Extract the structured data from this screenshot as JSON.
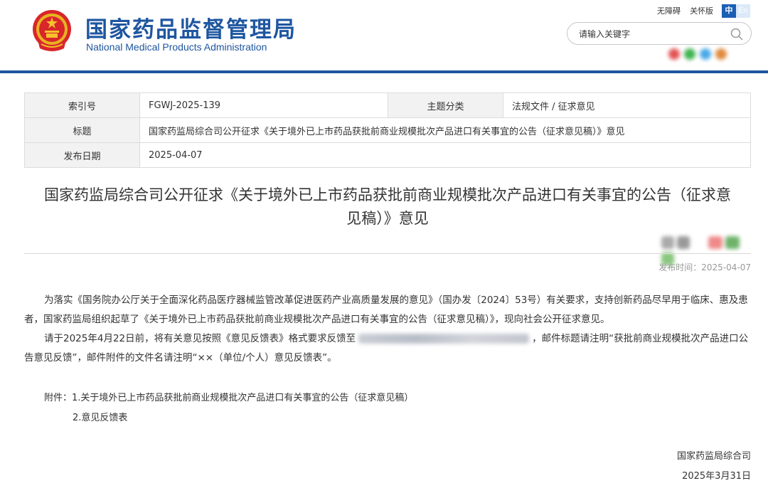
{
  "header": {
    "brand_cn": "国家药品监督管理局",
    "brand_en": "National Medical Products Administration",
    "accessibility_label": "无障碍",
    "elder_mode_label": "关怀版",
    "lang_zh": "中",
    "lang_en": "En",
    "search_placeholder": "请输入关键字",
    "brand_color": "#1e56a0"
  },
  "meta": {
    "index_label": "索引号",
    "index_value": "FGWJ-2025-139",
    "category_label": "主题分类",
    "category_value": "法规文件 / 征求意见",
    "title_label": "标题",
    "title_value": "国家药监局综合司公开征求《关于境外已上市药品获批前商业规模批次产品进口有关事宜的公告（征求意见稿）》意见",
    "date_label": "发布日期",
    "date_value": "2025-04-07"
  },
  "article": {
    "title_line1": "国家药监局综合司公开征求《关于境外已上市药品获批前商业规模批次产品进口有关事宜的公告（征求意",
    "title_line2": "见稿）》意见",
    "pubtime": "发布时间：2025-04-07",
    "para1": "为落实《国务院办公厅关于全面深化药品医疗器械监管改革促进医药产业高质量发展的意见》（国办发〔2024〕53号）有关要求，支持创新药品尽早用于临床、惠及患者，国家药监局组织起草了《关于境外已上市药品获批前商业规模批次产品进口有关事宜的公告（征求意见稿）》，现向社会公开征求意见。",
    "para2_before": "请于2025年4月22日前，将有关意见按照《意见反馈表》格式要求反馈至",
    "para2_after": "，邮件标题请注明“获批前商业规模批次产品进口公告意见反馈”，邮件附件的文件名请注明“××（单位/个人）意见反馈表”。",
    "attach_label": "附件：",
    "attach_1": "1.关于境外已上市药品获批前商业规模批次产品进口有关事宜的公告（征求意见稿）",
    "attach_2": "2.意见反馈表",
    "sign_org": "国家药监局综合司",
    "sign_date": "2025年3月31日"
  }
}
